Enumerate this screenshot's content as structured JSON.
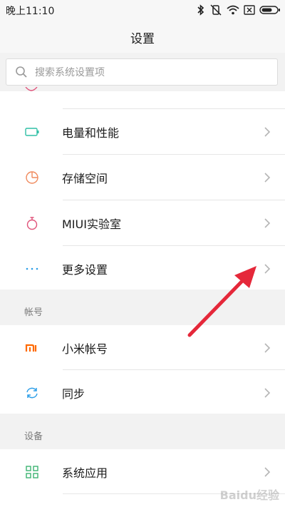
{
  "status_bar": {
    "time": "晚上11:10",
    "icons": [
      "bluetooth-icon",
      "vibrate-off-icon",
      "wifi-icon",
      "sim-none-icon",
      "battery-icon"
    ]
  },
  "header": {
    "title": "设置"
  },
  "search": {
    "placeholder": "搜索系统设置项"
  },
  "top_group": {
    "items": [
      {
        "label": "电量和性能",
        "icon": "battery-icon",
        "color": "#2fbfa5"
      },
      {
        "label": "存储空间",
        "icon": "storage-pie-icon",
        "color": "#f08a5d"
      },
      {
        "label": "MIUI实验室",
        "icon": "lab-flask-icon",
        "color": "#e0537a"
      },
      {
        "label": "更多设置",
        "icon": "more-dots-icon",
        "color": "#2c9ee8"
      }
    ]
  },
  "account_section": {
    "header": "帐号",
    "items": [
      {
        "label": "小米帐号",
        "icon": "mi-logo-icon",
        "color": "#ff6a00"
      },
      {
        "label": "同步",
        "icon": "sync-icon",
        "color": "#2c9ee8"
      }
    ]
  },
  "device_section": {
    "header": "设备",
    "items": [
      {
        "label": "系统应用",
        "icon": "apps-grid-icon",
        "color": "#3cb371"
      }
    ]
  },
  "annotation": {
    "arrow_color": "#e5283a"
  },
  "watermark": "Baidu经验"
}
